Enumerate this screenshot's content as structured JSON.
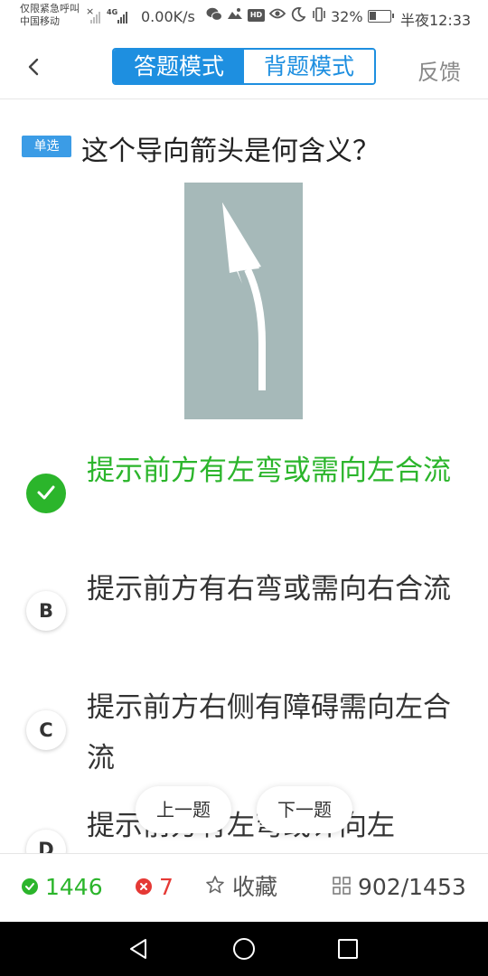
{
  "status_bar": {
    "carrier_line1": "仅限紧急呼叫",
    "carrier_line2": "中国移动",
    "network": "4G",
    "speed": "0.00K/s",
    "hd": "HD",
    "battery_percent": "32%",
    "battery_level": 0.32,
    "time": "半夜12:33",
    "icons": [
      "signal-icon",
      "wechat-icon",
      "gallery-icon",
      "eye-icon",
      "moon-icon",
      "vibrate-icon",
      "battery-icon"
    ]
  },
  "nav": {
    "back_icon": "back-arrow-icon",
    "tabs": [
      {
        "label": "答题模式",
        "active": true
      },
      {
        "label": "背题模式",
        "active": false
      }
    ],
    "feedback_label": "反馈"
  },
  "question": {
    "type_label": "单选",
    "text": "这个导向箭头是何含义？",
    "image_desc": "road-arrow-left-merge-image"
  },
  "options": [
    {
      "letter": "A",
      "text": "提示前方有左弯或需向左合流",
      "correct": true
    },
    {
      "letter": "B",
      "text": "提示前方有右弯或需向右合流",
      "correct": false
    },
    {
      "letter": "C",
      "text": "提示前方右侧有障碍需向左合流",
      "correct": false
    },
    {
      "letter": "D",
      "text": "提示前方有左弯或许向左",
      "correct": false
    }
  ],
  "floating": {
    "prev_label": "上一题",
    "next_label": "下一题"
  },
  "bottom_bar": {
    "right_count": "1446",
    "wrong_count": "7",
    "favorite_label": "收藏",
    "progress": "902/1453"
  },
  "colors": {
    "accent": "#1e8fe0",
    "correct": "#2bb52b",
    "wrong": "#e53935",
    "sign_bg": "#a6b9b9"
  }
}
